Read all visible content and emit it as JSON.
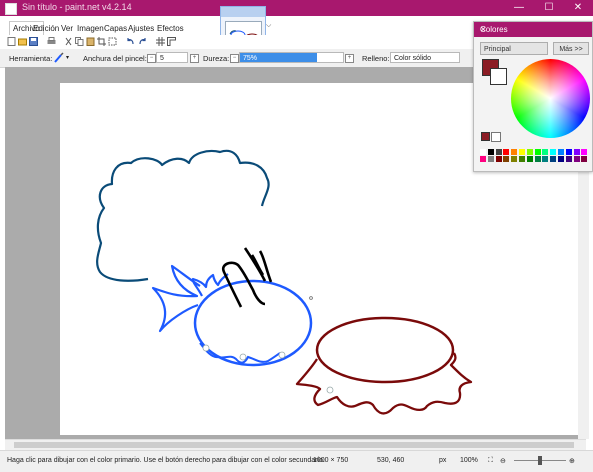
{
  "window": {
    "title": "Sin título - paint.net v4.2.14",
    "buttons": [
      "—",
      "☐",
      "✕"
    ]
  },
  "menu": [
    "Archivo",
    "Edición",
    "Ver",
    "Imagen",
    "Capas",
    "Ajustes",
    "Efectos"
  ],
  "tool_options": {
    "tool_label": "Herramienta:",
    "brush_width_label": "Anchura del pincel:",
    "brush_width_value": "5",
    "hardness_label": "Dureza:",
    "hardness_value": "75%",
    "hardness_fraction": 0.75,
    "fill_label": "Relleno:",
    "fill_value": "Color sólido"
  },
  "colors_panel": {
    "title": "Colores",
    "palette_select": "Principal",
    "more_button": "Más >>",
    "primary_color": "#8b1c24",
    "secondary_color": "#ffffff",
    "palette": [
      "#ffffff",
      "#000000",
      "#404040",
      "#ff0000",
      "#ff8000",
      "#ffff00",
      "#80ff00",
      "#00ff00",
      "#00ff80",
      "#00ffff",
      "#0080ff",
      "#0000ff",
      "#8000ff",
      "#ff00ff",
      "#ff0080",
      "#808080",
      "#800000",
      "#804000",
      "#808000",
      "#408000",
      "#008000",
      "#008040",
      "#008080",
      "#004080",
      "#000080",
      "#400080",
      "#800080",
      "#800040"
    ]
  },
  "status": {
    "hint": "Haga clic para dibujar con el color primario. Use el botón derecho para dibujar con el color secundario.",
    "image_size": "1000 × 750",
    "cursor_position": "530, 460",
    "unit": "px",
    "zoom": "100%"
  },
  "colors": {
    "accent": "#a8186e",
    "stroke_blue": "#1e5aff",
    "stroke_teal": "#0a4b78",
    "stroke_red": "#7a0a0a"
  }
}
